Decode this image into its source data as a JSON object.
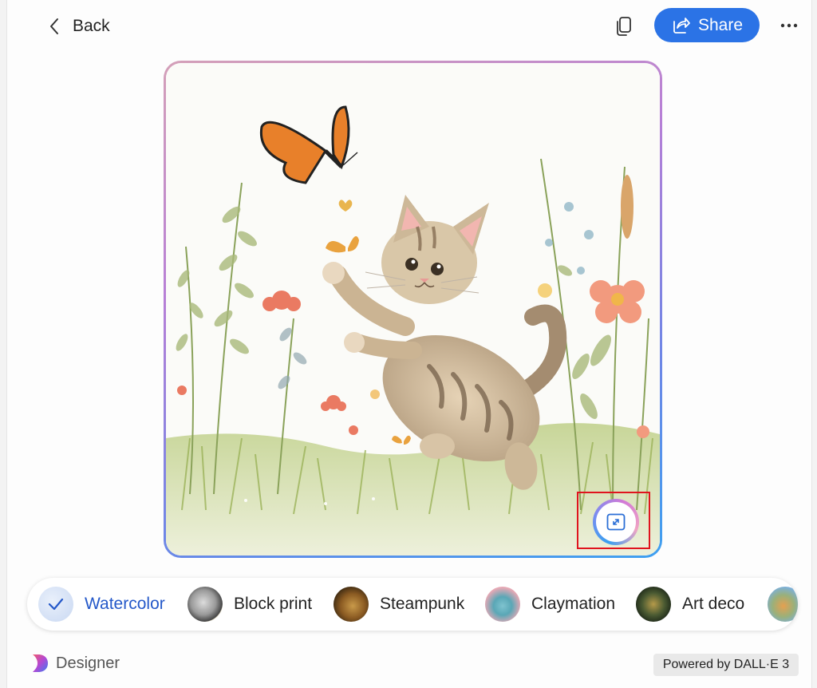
{
  "header": {
    "back_label": "Back",
    "share_label": "Share"
  },
  "image": {
    "description_icon": "generated-image",
    "expand_icon": "expand-icon"
  },
  "styles": {
    "items": [
      {
        "label": "Watercolor",
        "selected": true
      },
      {
        "label": "Block print",
        "selected": false
      },
      {
        "label": "Steampunk",
        "selected": false
      },
      {
        "label": "Claymation",
        "selected": false
      },
      {
        "label": "Art deco",
        "selected": false
      }
    ]
  },
  "footer": {
    "brand_name": "Designer",
    "powered_by": "Powered by DALL·E 3"
  },
  "colors": {
    "accent": "#2b73e6",
    "selected_text": "#2458c9",
    "highlight_box": "#e0141e"
  }
}
